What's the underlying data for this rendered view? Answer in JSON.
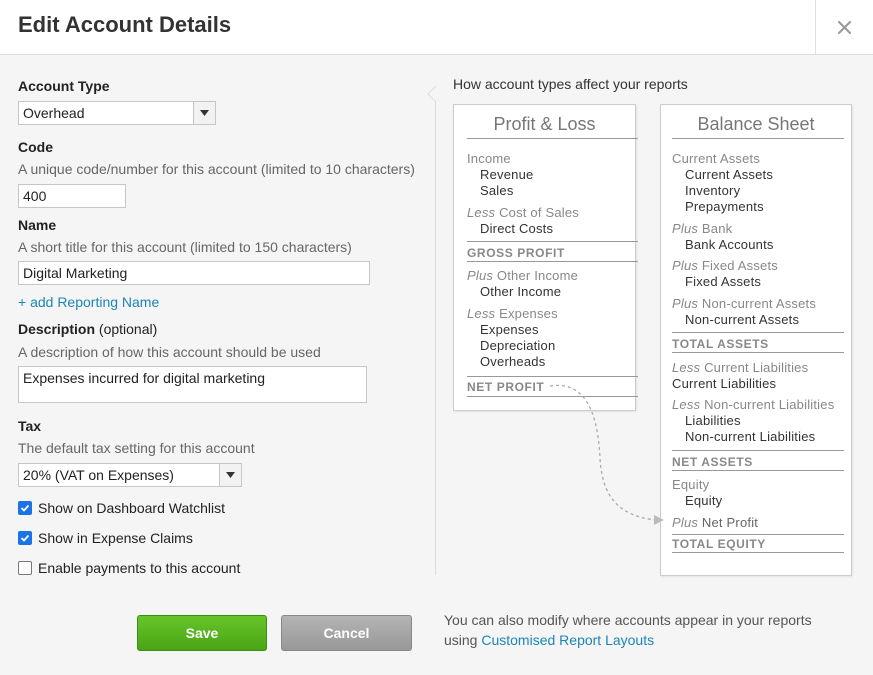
{
  "dialog": {
    "title": "Edit Account Details"
  },
  "account_type": {
    "label": "Account Type",
    "value": "Overhead"
  },
  "code": {
    "label": "Code",
    "hint": "A unique code/number for this account (limited to 10 characters)",
    "value": "400"
  },
  "name": {
    "label": "Name",
    "hint": "A short title for this account (limited to 150 characters)",
    "value": "Digital Marketing",
    "add_link": "+ add Reporting Name"
  },
  "description": {
    "label": "Description",
    "optional": "(optional)",
    "hint": "A description of how this account should be used",
    "value": "Expenses incurred for digital marketing"
  },
  "tax": {
    "label": "Tax",
    "hint": "The default tax setting for this account",
    "value": "20% (VAT on Expenses)"
  },
  "checkboxes": [
    {
      "label": "Show on Dashboard Watchlist",
      "checked": true
    },
    {
      "label": "Show in Expense Claims",
      "checked": true
    },
    {
      "label": "Enable payments to this account",
      "checked": false
    }
  ],
  "reports": {
    "title": "How account types affect your reports",
    "pl": {
      "heading": "Profit & Loss",
      "income": "Income",
      "revenue": "Revenue",
      "sales": "Sales",
      "less": "Less",
      "cost_of_sales": "Cost of Sales",
      "direct_costs": "Direct Costs",
      "gross_profit": "GROSS PROFIT",
      "plus": "Plus",
      "other_income_h": "Other Income",
      "other_income": "Other Income",
      "expenses_h": "Expenses",
      "expenses": "Expenses",
      "depreciation": "Depreciation",
      "overheads": "Overheads",
      "net_profit": "NET PROFIT"
    },
    "bs": {
      "heading": "Balance Sheet",
      "current_assets_h": "Current Assets",
      "current_assets": "Current Assets",
      "inventory": "Inventory",
      "prepayments": "Prepayments",
      "plus": "Plus",
      "less": "Less",
      "bank_h": "Bank",
      "bank_accounts": "Bank Accounts",
      "fixed_assets_h": "Fixed Assets",
      "fixed_assets": "Fixed Assets",
      "noncurrent_assets_h": "Non-current Assets",
      "noncurrent_assets": "Non-current Assets",
      "total_assets": "TOTAL ASSETS",
      "current_liab_h": "Current Liabilities",
      "current_liab": "Current Liabilities",
      "noncurrent_liab_h": "Non-current Liabilities",
      "liabilities": "Liabilities",
      "noncurrent_liab": "Non-current Liabilities",
      "net_assets": "NET ASSETS",
      "equity_h": "Equity",
      "equity": "Equity",
      "net_profit": "Net Profit",
      "total_equity": "TOTAL EQUITY"
    }
  },
  "buttons": {
    "save": "Save",
    "cancel": "Cancel"
  },
  "footnote": {
    "text": "You can also modify where accounts appear in your reports",
    "using": "using",
    "link": "Customised Report Layouts"
  },
  "colors": {
    "accent": "#1a86b8",
    "save": "#5ab520",
    "checkbox": "#1a73e8"
  }
}
